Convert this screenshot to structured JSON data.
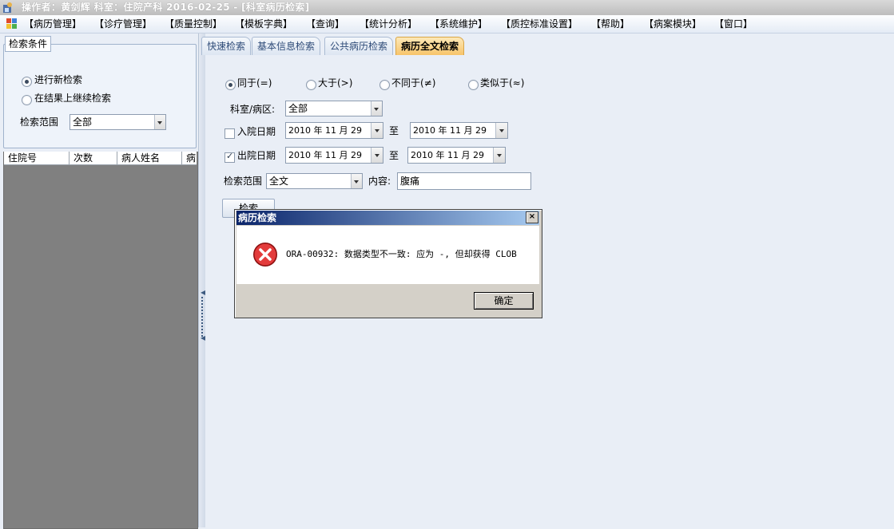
{
  "window": {
    "title": "操作者：黄剑辉   科室：住院产科   2016-02-25 - [科室病历检索]"
  },
  "menu": [
    "【病历管理】",
    "【诊疗管理】",
    "【质量控制】",
    "【模板字典】",
    "【查询】",
    "【统计分析】",
    "【系统维护】",
    "【质控标准设置】",
    "【帮助】",
    "【病案模块】",
    "【窗口】"
  ],
  "left_panel": {
    "group_title": "检索条件",
    "radio_new": "进行新检索",
    "radio_continue": "在结果上继续检索",
    "range_label": "检索范围",
    "range_value": "全部",
    "grid_columns": [
      "住院号",
      "次数",
      "病人姓名",
      "病"
    ]
  },
  "tabs": [
    "快速检索",
    "基本信息检索",
    "公共病历检索",
    "病历全文检索"
  ],
  "form": {
    "op_equal": "同于(=)",
    "op_greater": "大于(>)",
    "op_notequal": "不同于(≠)",
    "op_like": "类似于(≈)",
    "dept_label": "科室/病区:",
    "dept_value": "全部",
    "admit_label": "入院日期",
    "admit_from": "2010 年 11 月 29",
    "admit_to": "2010 年 11 月 29",
    "discharge_label": "出院日期",
    "discharge_from": "2010 年 11 月 29",
    "discharge_to": "2010 年 11 月 29",
    "to_label": "至",
    "scope_label": "检索范围",
    "scope_value": "全文",
    "content_label": "内容:",
    "content_value": "腹痛",
    "search_button": "检索"
  },
  "dialog": {
    "title": "病历检索",
    "message": "ORA-00932: 数据类型不一致: 应为 -, 但却获得 CLOB",
    "ok": "确定",
    "close": "×"
  },
  "colors": {
    "dialog_title": "#0a246a",
    "active_tab": "#f7c46a",
    "grid_bg": "#808080"
  },
  "icons": [
    "app-icon",
    "menu-icon",
    "error-icon",
    "close-icon",
    "dropdown-arrow-icon"
  ]
}
